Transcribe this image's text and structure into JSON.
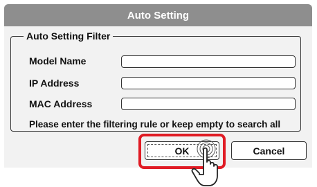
{
  "dialog": {
    "title": "Auto Setting"
  },
  "filter": {
    "legend": "Auto Setting Filter",
    "fields": [
      {
        "label": "Model Name",
        "value": ""
      },
      {
        "label": "IP Address",
        "value": ""
      },
      {
        "label": "MAC Address",
        "value": ""
      }
    ],
    "hint": "Please enter the filtering rule or keep empty to search all"
  },
  "buttons": {
    "ok_label": "OK",
    "cancel_label": "Cancel"
  },
  "colors": {
    "titlebar": "#8e8e8e",
    "highlight": "#e01b24",
    "dialog_bg": "#f2f2f2"
  },
  "icons": {
    "cursor": "hand-pointer-icon"
  }
}
